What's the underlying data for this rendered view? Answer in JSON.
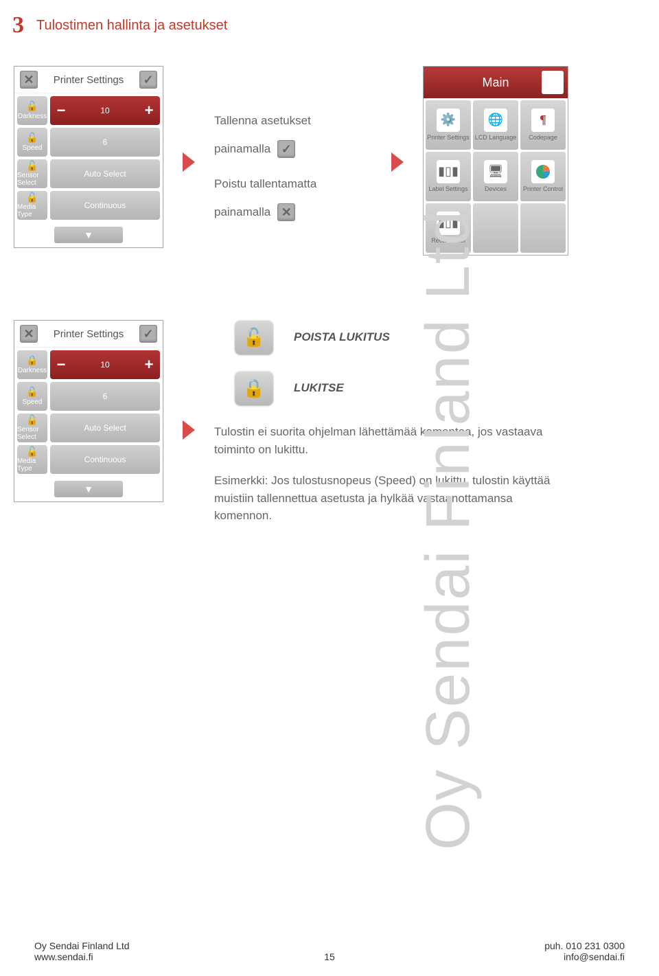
{
  "header": {
    "chapter": "3",
    "title": "Tulostimen hallinta ja asetukset"
  },
  "panelA": {
    "title": "Printer Settings",
    "rows": [
      {
        "label": "Darkness",
        "value": "10",
        "red": true
      },
      {
        "label": "Speed",
        "value": "6"
      },
      {
        "label": "Sensor Select",
        "value": "Auto Select"
      },
      {
        "label": "Media Type",
        "value": "Continuous"
      }
    ]
  },
  "instr": {
    "saveLine1": "Tallenna asetukset",
    "saveLine2": "painamalla",
    "exitLine1": "Poistu tallentamatta",
    "exitLine2": "painamalla"
  },
  "mainMenu": {
    "title": "Main",
    "items": [
      {
        "label": "Printer Settings"
      },
      {
        "label": "LCD Language"
      },
      {
        "label": "Codepage"
      },
      {
        "label": "Label Settings"
      },
      {
        "label": "Devices"
      },
      {
        "label": "Printer Control"
      },
      {
        "label": "Recall Label"
      },
      {
        "label": ""
      },
      {
        "label": ""
      }
    ]
  },
  "panelB": {
    "title": "Printer Settings",
    "rows": [
      {
        "label": "Darkness",
        "value": "10",
        "red": true
      },
      {
        "label": "Speed",
        "value": "6"
      },
      {
        "label": "Sensor Select",
        "value": "Auto Select"
      },
      {
        "label": "Media Type",
        "value": "Continuous"
      }
    ]
  },
  "lockLabels": {
    "open": "POISTA LUKITUS",
    "closed": "LUKITSE"
  },
  "body": {
    "p1": "Tulostin ei suorita ohjelman lähettämää komentoa, jos vastaava toiminto on lukittu.",
    "p2": "Esimerkki: Jos tulostusnopeus (Speed) on lukittu, tulostin käyttää muistiin tallennettua asetusta ja hylkää vastaanottamansa komennon."
  },
  "watermark": "Oy Sendai Finland Ltd",
  "footer": {
    "leftLine1": "Oy Sendai Finland Ltd",
    "leftLine2": "www.sendai.fi",
    "page": "15",
    "rightLine1": "puh. 010 231 0300",
    "rightLine2": "info@sendai.fi"
  }
}
